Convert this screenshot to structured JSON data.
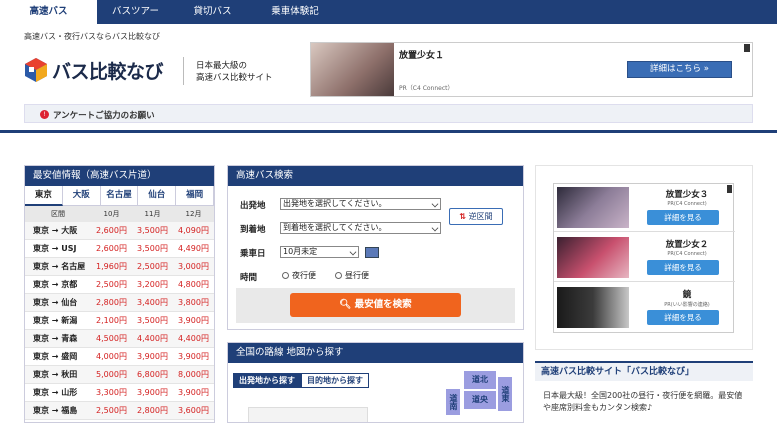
{
  "nav": {
    "tabs": [
      {
        "label": "高速バス",
        "active": true
      },
      {
        "label": "バスツアー",
        "active": false
      },
      {
        "label": "貸切バス",
        "active": false
      },
      {
        "label": "乗車体験記",
        "active": false
      }
    ]
  },
  "breadcrumb": "高速バス・夜行バスならバス比較なび",
  "logo_text": "バス比較なび",
  "tagline": [
    "日本最大級の",
    "高速バス比較サイト"
  ],
  "ad_top": {
    "title": "放置少女１",
    "pr": "PR（C4 Connect）",
    "button": "詳細はこちら »"
  },
  "survey": {
    "text": "アンケートご協力のお願い",
    "icon": "exclamation-icon"
  },
  "price_panel": {
    "title": "最安値情報（高速バス片道）",
    "city_tabs": [
      "東京",
      "大阪",
      "名古屋",
      "仙台",
      "福岡"
    ],
    "active_tab": "東京",
    "columns": [
      "区間",
      "10月",
      "11月",
      "12月"
    ],
    "rows": [
      [
        "東京 → 大阪",
        "2,600円",
        "3,500円",
        "4,090円"
      ],
      [
        "東京 → USJ",
        "2,600円",
        "3,500円",
        "4,490円"
      ],
      [
        "東京 → 名古屋",
        "1,960円",
        "2,500円",
        "3,000円"
      ],
      [
        "東京 → 京都",
        "2,500円",
        "3,200円",
        "4,800円"
      ],
      [
        "東京 → 仙台",
        "2,800円",
        "3,400円",
        "3,800円"
      ],
      [
        "東京 → 新潟",
        "2,100円",
        "3,500円",
        "3,900円"
      ],
      [
        "東京 → 青森",
        "4,500円",
        "4,400円",
        "4,400円"
      ],
      [
        "東京 → 盛岡",
        "4,000円",
        "3,900円",
        "3,900円"
      ],
      [
        "東京 → 秋田",
        "5,000円",
        "6,800円",
        "8,000円"
      ],
      [
        "東京 → 山形",
        "3,300円",
        "3,900円",
        "3,900円"
      ],
      [
        "東京 → 福島",
        "2,500円",
        "2,800円",
        "3,600円"
      ]
    ]
  },
  "search_panel": {
    "title": "高速バス検索",
    "from_label": "出発地",
    "from_value": "出発地を選択してください。",
    "to_label": "到着地",
    "to_value": "到着地を選択してください。",
    "swap_label": "逆区間",
    "date_label": "乗車日",
    "date_value": "10月未定",
    "time_label": "時間",
    "radio_night": "夜行便",
    "radio_day": "昼行便",
    "submit_label": "最安値を検索"
  },
  "map_panel": {
    "title": "全国の路線 地図から探す",
    "tab_from": "出発地から探す",
    "tab_to": "目的地から探す",
    "regions": [
      "道北",
      "道央",
      "道東",
      "道南"
    ]
  },
  "ad_side": {
    "items": [
      {
        "title": "放置少女３",
        "pr": "PR(C4 Connect)",
        "button": "詳細を見る"
      },
      {
        "title": "放置少女２",
        "pr": "PR(C4 Connect)",
        "button": "詳細を見る"
      },
      {
        "title": "鏡",
        "pr": "PR(いい影響の連絡)",
        "button": "詳細を見る"
      }
    ]
  },
  "about": {
    "title": "高速バス比較サイト「バス比較なび」",
    "body": "日本最大級！全国200社の昼行・夜行便を網羅。最安値や座席別料金もカンタン検索♪"
  },
  "colors": {
    "navy": "#1f3f78",
    "price_red": "#d42020",
    "search_orange": "#f0641e",
    "region_purple": "#9b9de0"
  }
}
